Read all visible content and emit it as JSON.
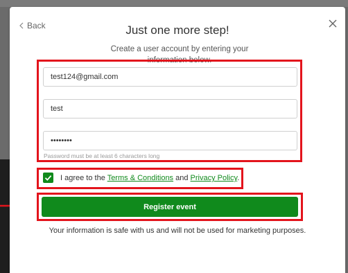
{
  "modal": {
    "back_label": "Back",
    "title": "Just one more step!",
    "subtitle": "Create a user account by entering your information below."
  },
  "form": {
    "email_value": "test124@gmail.com",
    "name_value": "test",
    "password_value": "password",
    "password_hint": "Password must be at least 6 characters long"
  },
  "terms": {
    "checked": true,
    "prefix": "I agree to the ",
    "terms_link": "Terms & Conditions",
    "middle": " and ",
    "privacy_link": "Privacy Policy",
    "suffix": "."
  },
  "register_label": "Register event",
  "privacy_note": "Your information is safe with us and will not be used for marketing purposes.",
  "colors": {
    "accent_green": "#108a1c",
    "highlight_red": "#e3141c"
  },
  "icons": {
    "back": "chevron-left-icon",
    "close": "close-icon",
    "check": "checkmark-icon",
    "arrow": "arrow-right-icon"
  }
}
